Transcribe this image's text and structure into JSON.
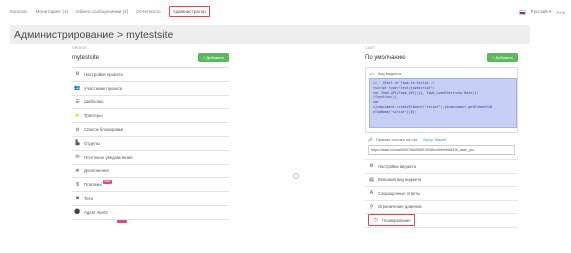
{
  "topbar": {
    "nav": [
      {
        "label": "Консоль",
        "active": false
      },
      {
        "label": "Мониторинг (1)",
        "active": false
      },
      {
        "label": "Обмен сообщениями (2)",
        "active": false
      },
      {
        "label": "Отчетность",
        "active": false
      },
      {
        "label": "Администратор",
        "active": true
      }
    ],
    "language": "Русский ▾",
    "user": "A cs"
  },
  "heading": {
    "title": "Администрирование > mytestsite"
  },
  "left": {
    "section_caption": "ПРОЕКТ",
    "project_name": "mytestsite",
    "add_label": "+ Добавить",
    "menu": [
      {
        "icon": "gear-icon",
        "glyph": "⚙",
        "label": "Настройки проекта"
      },
      {
        "icon": "users-icon",
        "glyph": "👥",
        "label": "Участники проекта"
      },
      {
        "icon": "templates-icon",
        "glyph": "☰",
        "label": "Шаблоны"
      },
      {
        "icon": "trigger-icon",
        "glyph": "⚡",
        "label": "Триггеры"
      },
      {
        "icon": "block-icon",
        "glyph": "⊘",
        "label": "Список блокировки"
      },
      {
        "icon": "departments-icon",
        "glyph": "▙",
        "label": "Отделы"
      },
      {
        "icon": "mail-icon",
        "glyph": "✉",
        "label": "Почтовые уведомления"
      },
      {
        "icon": "addons-icon",
        "glyph": "⛯",
        "label": "Дополнения"
      },
      {
        "icon": "dollar-icon",
        "glyph": "$",
        "label": "Платежи",
        "badge": "NEW"
      },
      {
        "icon": "tags-icon",
        "glyph": "⚑",
        "label": "Теги"
      },
      {
        "icon": "agent-icon",
        "glyph": "⚫",
        "label": "Agent Alerts"
      }
    ]
  },
  "right": {
    "section_caption": "САЙТ",
    "site_name": "По умолчанию",
    "add_label": "+ Добавить",
    "code_title": "Код виджета",
    "code_lines": [
      "<!-- Start of Tawk.to Script-->",
      "<script type=\"text/javascript\">",
      "var Tawk_API=Tawk_API||{}, Tawk_LoadStart=new Date();",
      "(function(){",
      "var",
      "s1=document.createElement(\"script\"),s0=document.getElementsB",
      "yTagName(\"script\")[0];"
    ],
    "link_label": "Прямая ссылка на чат",
    "link_example": "Смотр. Вашей",
    "link_url": "https://tawk.to/chat/59478a0f36ff13f3dfbc3b5fe9faf/1f8_tawk_pro",
    "menu": [
      {
        "icon": "gear-icon",
        "glyph": "⚙",
        "label": "Настройки виджета"
      },
      {
        "icon": "widget-icon",
        "glyph": "▤",
        "label": "Внешний вид виджета"
      },
      {
        "icon": "shortcut-icon",
        "glyph": "A",
        "label": "Сокращенные ответы"
      },
      {
        "icon": "domain-icon",
        "glyph": "⚲",
        "label": "Ограничение доменов"
      },
      {
        "icon": "clock-icon",
        "glyph": "◷",
        "label": "Планирование",
        "highlighted": true
      }
    ]
  },
  "colors": {
    "highlight": "#e2473f",
    "add_button": "#5cb85c",
    "code_bg": "#c6cef4",
    "badge": "#e84393"
  }
}
